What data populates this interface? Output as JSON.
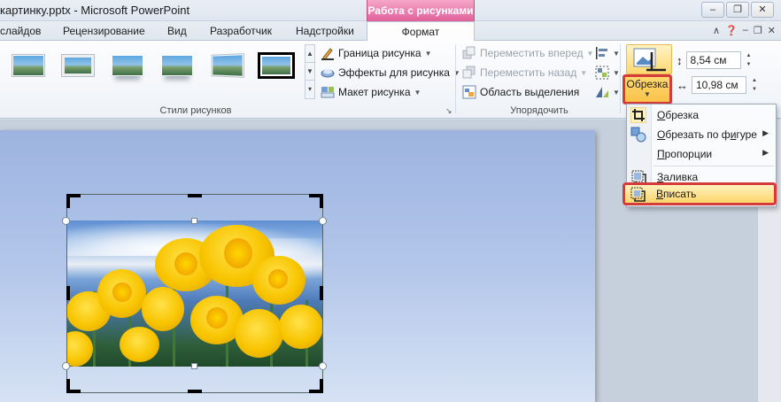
{
  "window": {
    "title": "картинку.pptx - Microsoft PowerPoint",
    "context_tab_header": "Работа с рисунками",
    "controls": [
      "minimize",
      "restore",
      "close"
    ]
  },
  "tabs": [
    {
      "label": "слайдов",
      "active": false
    },
    {
      "label": "Рецензирование",
      "active": false
    },
    {
      "label": "Вид",
      "active": false
    },
    {
      "label": "Разработчик",
      "active": false
    },
    {
      "label": "Надстройки",
      "active": false
    },
    {
      "label": "Формат",
      "active": true
    }
  ],
  "ribbon": {
    "picture_styles": {
      "group_label": "Стили рисунков",
      "thumbnails": [
        "simple-frame-white",
        "beveled-matte-white",
        "reflected-rounded",
        "reflected-bevel",
        "perspective-shadow",
        "thick-black-frame"
      ],
      "selected_index": 5,
      "commands": {
        "border": "Граница рисунка",
        "effects": "Эффекты для рисунка",
        "layout": "Макет рисунка"
      }
    },
    "arrange": {
      "group_label": "Упорядочить",
      "commands": {
        "bring_forward": "Переместить вперед",
        "send_backward": "Переместить назад",
        "selection_pane": "Область выделения"
      }
    },
    "size": {
      "crop_label": "Обрезка",
      "height": "8,54 см",
      "width": "10,98 см"
    }
  },
  "crop_menu": {
    "items": [
      {
        "label": "Обрезка",
        "underline": "О",
        "rest": "брезка",
        "has_submenu": false
      },
      {
        "label": "Обрезать по фигуре",
        "underline": "О",
        "rest": "брезать по ф",
        "underline2": "и",
        "rest2": "гуре",
        "has_submenu": true
      },
      {
        "label": "Пропорции",
        "underline": "П",
        "rest": "ропорции",
        "has_submenu": true
      },
      {
        "label": "Заливка",
        "underline": "З",
        "rest": "аливка",
        "has_submenu": false
      },
      {
        "label": "Вписать",
        "underline": "В",
        "rest": "писать",
        "has_submenu": false,
        "highlighted": true
      }
    ]
  },
  "colors": {
    "context_tab": "#e0609a",
    "highlight_border": "#d63b3b",
    "menu_highlight": "#fbd56a",
    "slide_background": "#b3c6ea"
  }
}
